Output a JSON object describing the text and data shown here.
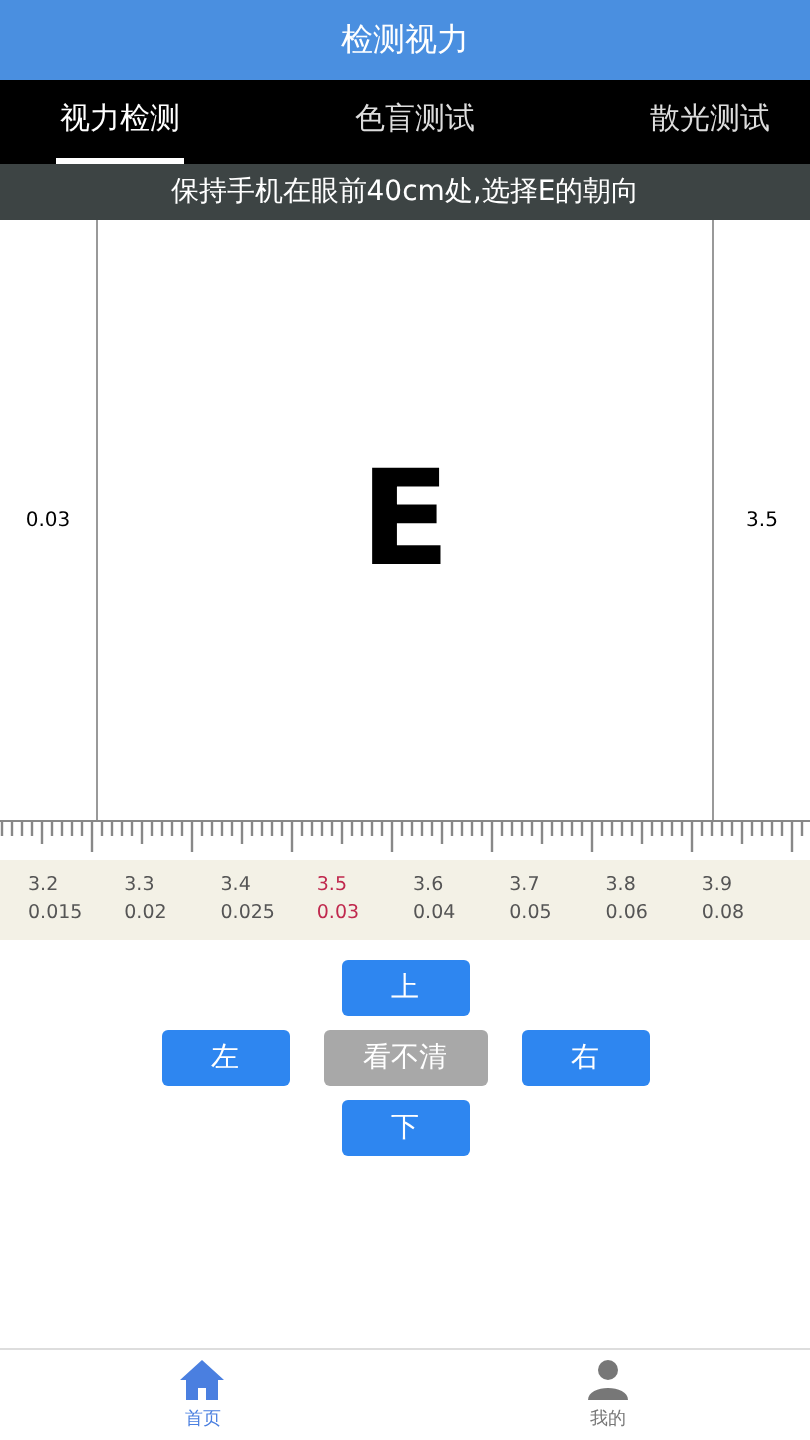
{
  "header": {
    "title": "检测视力"
  },
  "tabs": [
    {
      "label": "视力检测",
      "selected": true
    },
    {
      "label": "色盲测试",
      "selected": false
    },
    {
      "label": "散光测试",
      "selected": false
    }
  ],
  "instruction": "保持手机在眼前40cm处,选择E的朝向",
  "chart": {
    "left_label": "0.03",
    "optotype": "E",
    "right_label": "3.5"
  },
  "scale": [
    {
      "score": "3.2",
      "acuity": "0.015",
      "selected": false
    },
    {
      "score": "3.3",
      "acuity": "0.02",
      "selected": false
    },
    {
      "score": "3.4",
      "acuity": "0.025",
      "selected": false
    },
    {
      "score": "3.5",
      "acuity": "0.03",
      "selected": true
    },
    {
      "score": "3.6",
      "acuity": "0.04",
      "selected": false
    },
    {
      "score": "3.7",
      "acuity": "0.05",
      "selected": false
    },
    {
      "score": "3.8",
      "acuity": "0.06",
      "selected": false
    },
    {
      "score": "3.9",
      "acuity": "0.08",
      "selected": false
    }
  ],
  "controls": {
    "up": "上",
    "left": "左",
    "unclear": "看不清",
    "right": "右",
    "down": "下"
  },
  "nav": [
    {
      "label": "首页",
      "kind": "home",
      "selected": true
    },
    {
      "label": "我的",
      "kind": "profile",
      "selected": false
    }
  ]
}
